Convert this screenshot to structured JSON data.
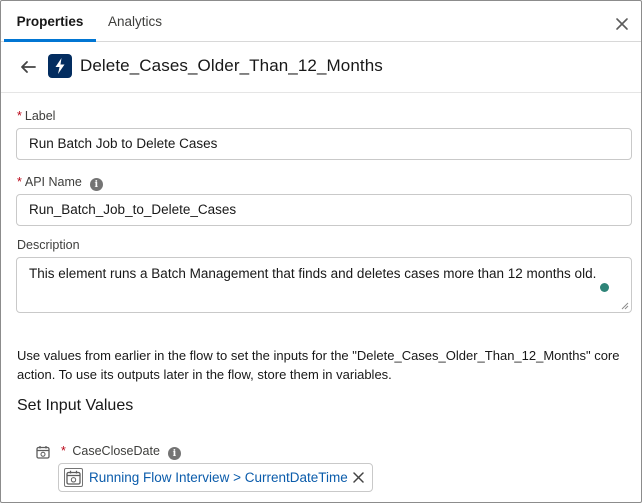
{
  "tabs": {
    "properties": "Properties",
    "analytics": "Analytics"
  },
  "header": {
    "title": "Delete_Cases_Older_Than_12_Months"
  },
  "form": {
    "required_mark": "*",
    "label": {
      "caption": "Label",
      "value": "Run Batch Job to Delete Cases"
    },
    "api_name": {
      "caption": "API Name",
      "value": "Run_Batch_Job_to_Delete_Cases"
    },
    "description": {
      "caption": "Description",
      "value": "This element runs a Batch Management that finds and deletes cases more than 12 months old."
    }
  },
  "help_text": "Use values from earlier in the flow to set the inputs for the \"Delete_Cases_Older_Than_12_Months\" core action. To use its outputs later in the flow, store them in variables.",
  "inputs_section": {
    "title": "Set Input Values",
    "parameter": {
      "label": "CaseCloseDate",
      "value": "Running Flow Interview > CurrentDateTime"
    }
  },
  "icons": {
    "close": "close-icon",
    "back": "back-arrow-icon",
    "action": "lightning-bolt-icon",
    "info": "info-icon",
    "calendar": "calendar-icon",
    "remove": "remove-icon"
  },
  "colors": {
    "accent": "#0176d3",
    "action_icon_bg": "#032d60",
    "required": "#ba0517",
    "link": "#0b5cab",
    "badge": "#2e8478"
  }
}
